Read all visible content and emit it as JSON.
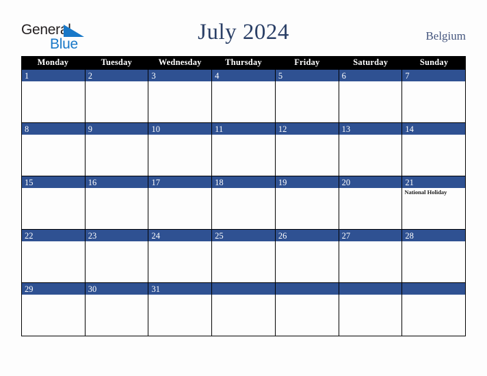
{
  "brand": {
    "name_part1": "General",
    "name_part2": "Blue",
    "triangle_icon": "blue-triangle-icon",
    "color_dark": "#231f20",
    "color_blue": "#1878c8"
  },
  "header": {
    "title": "July 2024",
    "country": "Belgium",
    "title_color": "#2a3f66",
    "country_color": "#45567e"
  },
  "calendar": {
    "weekdays": [
      "Monday",
      "Tuesday",
      "Wednesday",
      "Thursday",
      "Friday",
      "Saturday",
      "Sunday"
    ],
    "header_bg": "#000000",
    "header_fg": "#ffffff",
    "date_band_bg": "#2f5192",
    "date_band_fg": "#ffffff",
    "cell_bg": "#fdfdfd",
    "border_color": "#000000",
    "weeks": [
      [
        {
          "day": "1",
          "events": []
        },
        {
          "day": "2",
          "events": []
        },
        {
          "day": "3",
          "events": []
        },
        {
          "day": "4",
          "events": []
        },
        {
          "day": "5",
          "events": []
        },
        {
          "day": "6",
          "events": []
        },
        {
          "day": "7",
          "events": []
        }
      ],
      [
        {
          "day": "8",
          "events": []
        },
        {
          "day": "9",
          "events": []
        },
        {
          "day": "10",
          "events": []
        },
        {
          "day": "11",
          "events": []
        },
        {
          "day": "12",
          "events": []
        },
        {
          "day": "13",
          "events": []
        },
        {
          "day": "14",
          "events": []
        }
      ],
      [
        {
          "day": "15",
          "events": []
        },
        {
          "day": "16",
          "events": []
        },
        {
          "day": "17",
          "events": []
        },
        {
          "day": "18",
          "events": []
        },
        {
          "day": "19",
          "events": []
        },
        {
          "day": "20",
          "events": []
        },
        {
          "day": "21",
          "events": [
            "National Holiday"
          ]
        }
      ],
      [
        {
          "day": "22",
          "events": []
        },
        {
          "day": "23",
          "events": []
        },
        {
          "day": "24",
          "events": []
        },
        {
          "day": "25",
          "events": []
        },
        {
          "day": "26",
          "events": []
        },
        {
          "day": "27",
          "events": []
        },
        {
          "day": "28",
          "events": []
        }
      ],
      [
        {
          "day": "29",
          "events": []
        },
        {
          "day": "30",
          "events": []
        },
        {
          "day": "31",
          "events": []
        },
        {
          "day": "",
          "events": []
        },
        {
          "day": "",
          "events": []
        },
        {
          "day": "",
          "events": []
        },
        {
          "day": "",
          "events": []
        }
      ]
    ]
  }
}
